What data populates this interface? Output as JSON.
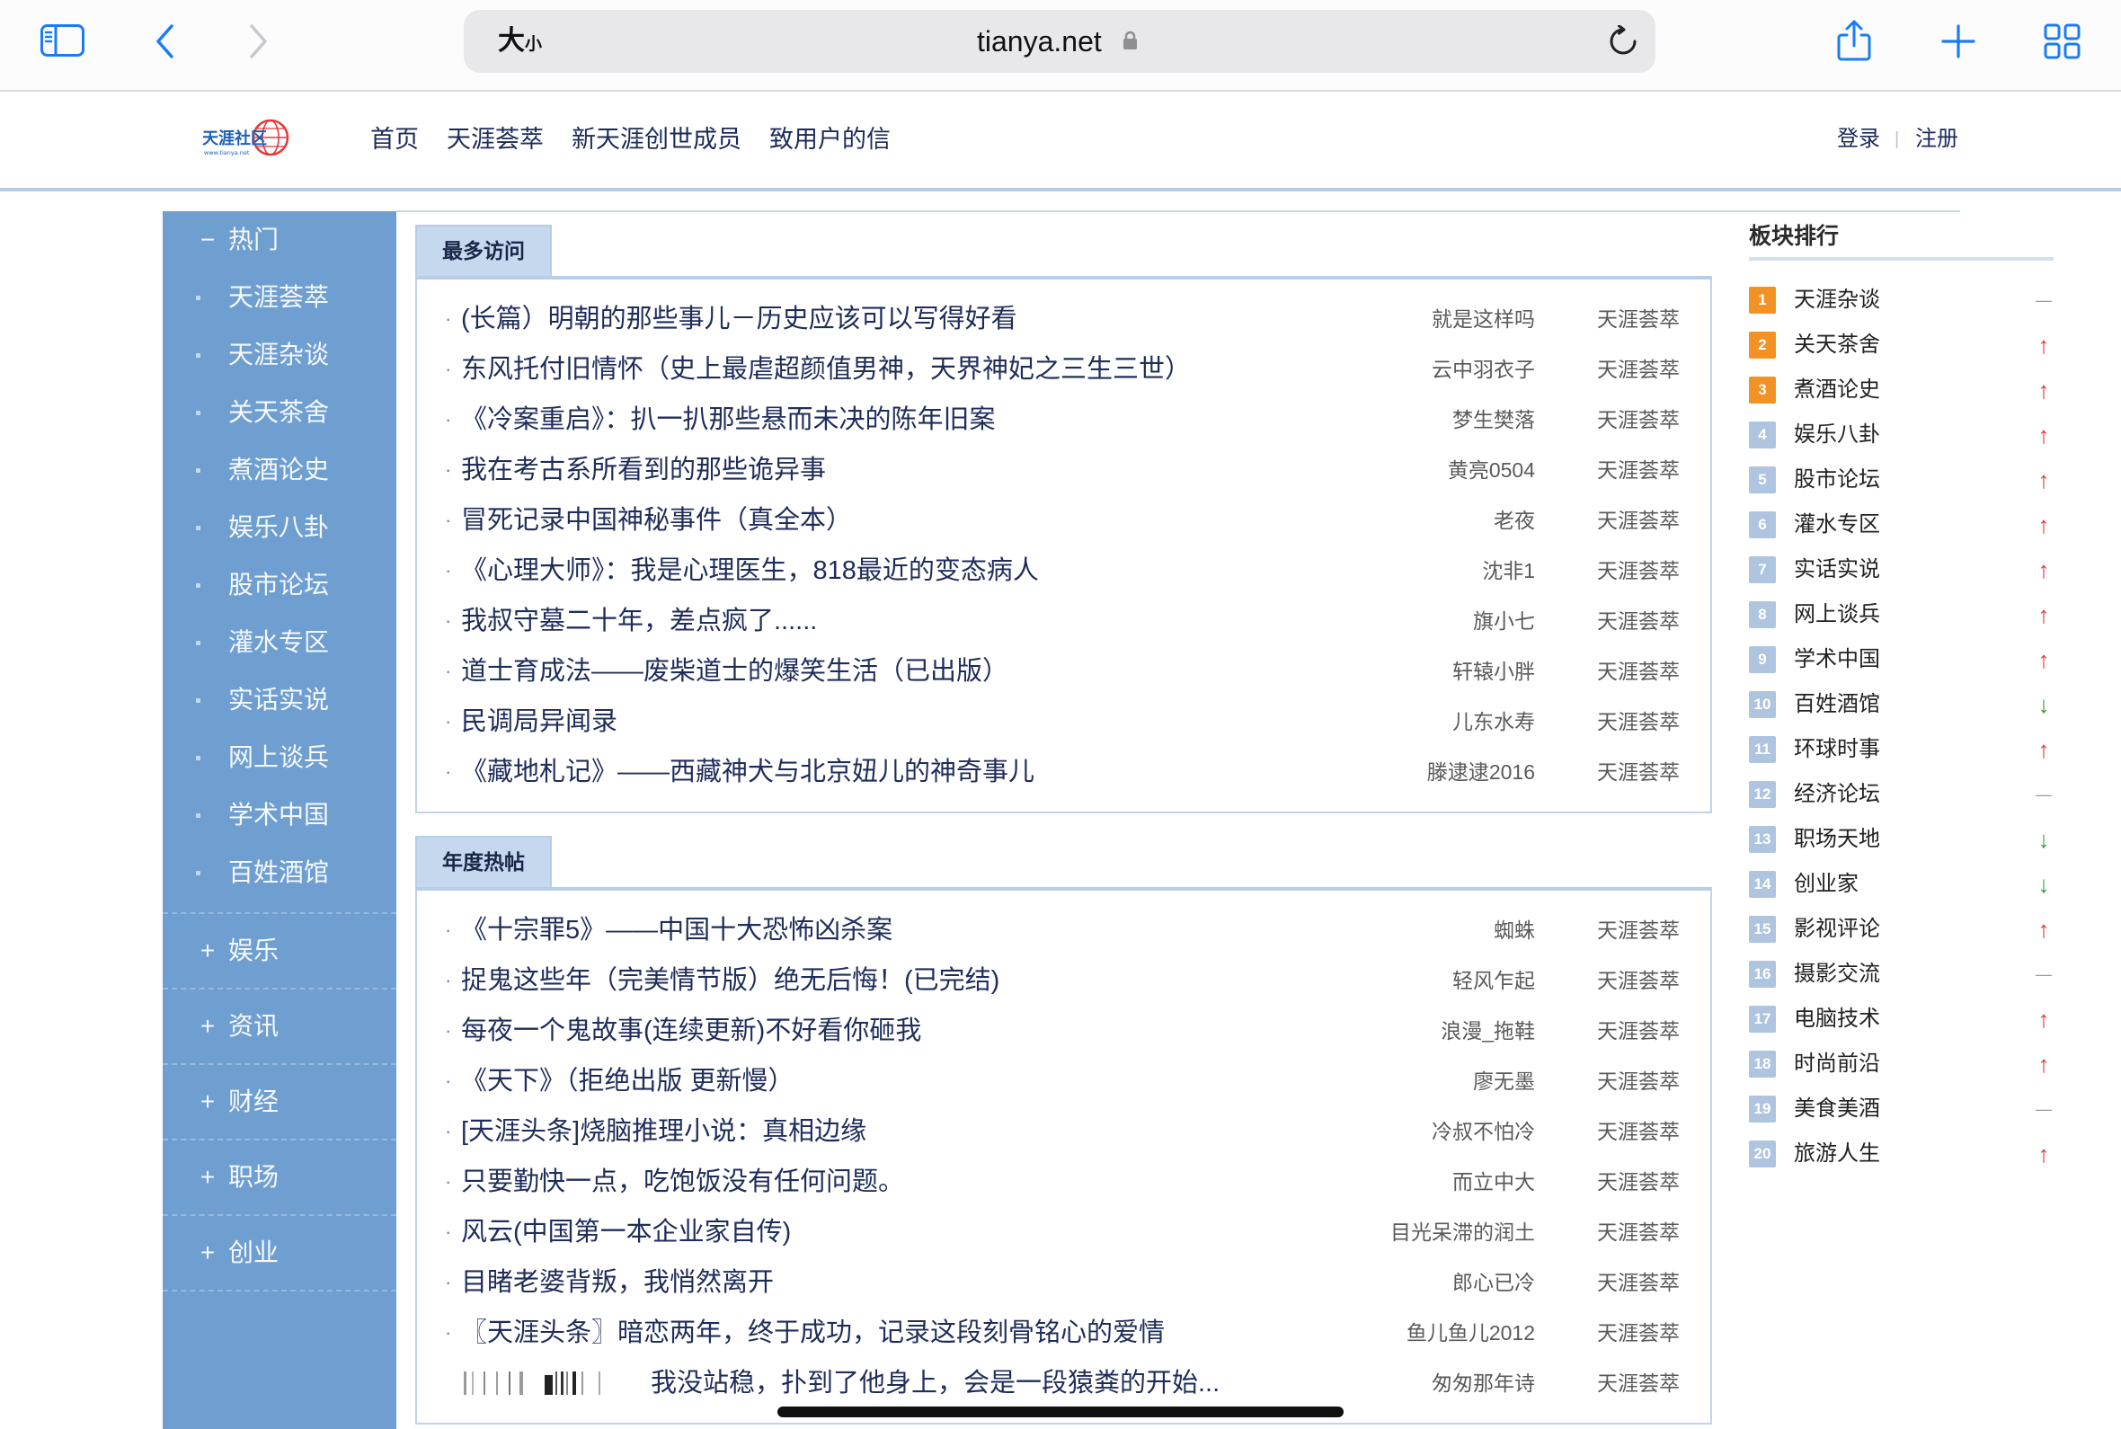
{
  "browser": {
    "reader_big": "大",
    "reader_small": "小",
    "url": "tianya.net",
    "icons": [
      "sidebar-icon",
      "back-chevron-icon",
      "forward-chevron-icon",
      "lock-icon",
      "reload-icon",
      "share-icon",
      "plus-icon",
      "tabs-grid-icon"
    ]
  },
  "header": {
    "logo_text": "天涯社区",
    "logo_url_text": "www.tianya.net",
    "nav": [
      "首页",
      "天涯荟萃",
      "新天涯创世成员",
      "致用户的信"
    ],
    "login": "登录",
    "separator": "|",
    "register": "注册"
  },
  "sidebar": {
    "expanded_group": {
      "toggle": "−",
      "label": "热门",
      "items": [
        "天涯荟萃",
        "天涯杂谈",
        "关天茶舍",
        "煮酒论史",
        "娱乐八卦",
        "股市论坛",
        "灌水专区",
        "实话实说",
        "网上谈兵",
        "学术中国",
        "百姓酒馆"
      ]
    },
    "collapsed_groups": [
      {
        "toggle": "+",
        "label": "娱乐"
      },
      {
        "toggle": "+",
        "label": "资讯"
      },
      {
        "toggle": "+",
        "label": "财经"
      },
      {
        "toggle": "+",
        "label": "职场"
      },
      {
        "toggle": "+",
        "label": "创业"
      }
    ]
  },
  "sections": [
    {
      "tab": "最多访问",
      "rows": [
        {
          "bullet": "·",
          "title": "(长篇）明朝的那些事儿－历史应该可以写得好看",
          "author": "就是这样吗",
          "board": "天涯荟萃"
        },
        {
          "bullet": "·",
          "title": "东风托付旧情怀（史上最虐超颜值男神，天界神妃之三生三世）",
          "author": "云中羽衣子",
          "board": "天涯荟萃"
        },
        {
          "bullet": "·",
          "title": "《冷案重启》：扒一扒那些悬而未决的陈年旧案",
          "author": "梦生樊落",
          "board": "天涯荟萃"
        },
        {
          "bullet": "·",
          "title": "我在考古系所看到的那些诡异事",
          "author": "黄亮0504",
          "board": "天涯荟萃"
        },
        {
          "bullet": "·",
          "title": "冒死记录中国神秘事件（真全本）",
          "author": "老夜",
          "board": "天涯荟萃"
        },
        {
          "bullet": "·",
          "title": "《心理大师》：我是心理医生，818最近的变态病人",
          "author": "沈非1",
          "board": "天涯荟萃"
        },
        {
          "bullet": "·",
          "title": "我叔守墓二十年，差点疯了......",
          "author": "旗小七",
          "board": "天涯荟萃"
        },
        {
          "bullet": "·",
          "title": "道士育成法——废柴道士的爆笑生活（已出版）",
          "author": "轩辕小胖",
          "board": "天涯荟萃"
        },
        {
          "bullet": "·",
          "title": "民调局异闻录",
          "author": "儿东水寿",
          "board": "天涯荟萃"
        },
        {
          "bullet": "·",
          "title": "《藏地札记》——西藏神犬与北京妞儿的神奇事儿",
          "author": "滕逮逮2016",
          "board": "天涯荟萃"
        }
      ]
    },
    {
      "tab": "年度热帖",
      "rows": [
        {
          "bullet": "·",
          "title": "《十宗罪5》——中国十大恐怖凶杀案",
          "author": "蜘蛛",
          "board": "天涯荟萃"
        },
        {
          "bullet": "·",
          "title": "捉鬼这些年（完美情节版）绝无后悔！(已完结)",
          "author": "轻风乍起",
          "board": "天涯荟萃"
        },
        {
          "bullet": "·",
          "title": "每夜一个鬼故事(连续更新)不好看你砸我",
          "author": "浪漫_拖鞋",
          "board": "天涯荟萃"
        },
        {
          "bullet": "·",
          "title": "《天下》（拒绝出版 更新慢）",
          "author": "廖无墨",
          "board": "天涯荟萃"
        },
        {
          "bullet": "·",
          "title": "[天涯头条]烧脑推理小说：真相边缘",
          "author": "冷叔不怕冷",
          "board": "天涯荟萃"
        },
        {
          "bullet": "·",
          "title": "只要勤快一点，吃饱饭没有任何问题。",
          "author": "而立中大",
          "board": "天涯荟萃"
        },
        {
          "bullet": "·",
          "title": "风云(中国第一本企业家自传)",
          "author": "目光呆滞的润土",
          "board": "天涯荟萃"
        },
        {
          "bullet": "·",
          "title": "目睹老婆背叛，我悄然离开",
          "author": "郎心已冷",
          "board": "天涯荟萃"
        },
        {
          "bullet": "·",
          "title": "〖天涯头条〗暗恋两年，终于成功，记录这段刻骨铭心的爱情",
          "author": "鱼儿鱼儿2012",
          "board": "天涯荟萃"
        },
        {
          "title": "我没站稳，扑到了他身上，会是一段猿粪的开始...",
          "author": "匆匆那年诗",
          "board": "天涯荟萃",
          "has_thumbnail": true
        }
      ]
    }
  ],
  "ranking": {
    "title": "板块排行",
    "items": [
      {
        "rank": "1",
        "name": "天涯杂谈",
        "trend": "—"
      },
      {
        "rank": "2",
        "name": "关天茶舍",
        "trend": "↑"
      },
      {
        "rank": "3",
        "name": "煮酒论史",
        "trend": "↑"
      },
      {
        "rank": "4",
        "name": "娱乐八卦",
        "trend": "↑"
      },
      {
        "rank": "5",
        "name": "股市论坛",
        "trend": "↑"
      },
      {
        "rank": "6",
        "name": "灌水专区",
        "trend": "↑"
      },
      {
        "rank": "7",
        "name": "实话实说",
        "trend": "↑"
      },
      {
        "rank": "8",
        "name": "网上谈兵",
        "trend": "↑"
      },
      {
        "rank": "9",
        "name": "学术中国",
        "trend": "↑"
      },
      {
        "rank": "10",
        "name": "百姓酒馆",
        "trend": "↓"
      },
      {
        "rank": "11",
        "name": "环球时事",
        "trend": "↑"
      },
      {
        "rank": "12",
        "name": "经济论坛",
        "trend": "—"
      },
      {
        "rank": "13",
        "name": "职场天地",
        "trend": "↓"
      },
      {
        "rank": "14",
        "name": "创业家",
        "trend": "↓"
      },
      {
        "rank": "15",
        "name": "影视评论",
        "trend": "↑"
      },
      {
        "rank": "16",
        "name": "摄影交流",
        "trend": "—"
      },
      {
        "rank": "17",
        "name": "电脑技术",
        "trend": "↑"
      },
      {
        "rank": "18",
        "name": "时尚前沿",
        "trend": "↑"
      },
      {
        "rank": "19",
        "name": "美食美酒",
        "trend": "—"
      },
      {
        "rank": "20",
        "name": "旅游人生",
        "trend": "↑"
      }
    ]
  },
  "colors": {
    "ios_blue": "#1a7cf5",
    "sidebar_bg": "#6f9fd1",
    "link_navy": "#1f2d5a",
    "rank_top": "#f39224",
    "rank_other": "#aec4df",
    "trend_up": "#e5323a",
    "trend_down": "#2a9d3e",
    "trend_flat": "#9a9a9a"
  }
}
